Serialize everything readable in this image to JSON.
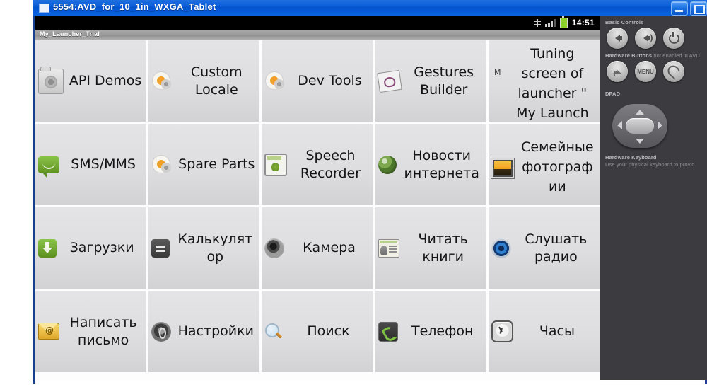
{
  "window": {
    "title": "5554:AVD_for_10_1in_WXGA_Tablet",
    "minimize_label": "",
    "maximize_label": ""
  },
  "statusbar": {
    "time": "14:51",
    "icons": [
      "usb-debug-icon",
      "signal-icon",
      "battery-icon"
    ]
  },
  "appbar": {
    "title": "My_Launcher_Trial"
  },
  "grid": {
    "cells": [
      {
        "label": "API Demos",
        "icon": "folder-gear-icon",
        "tall": false
      },
      {
        "label": "Custom Locale",
        "icon": "gear-flower-icon",
        "tall": false
      },
      {
        "label": "Dev Tools",
        "icon": "gear-flower-icon",
        "tall": false
      },
      {
        "label": "Gestures Builder",
        "icon": "gestures-icon",
        "tall": false
      },
      {
        "label": "Tuning screen of launcher \" My Launch",
        "icon": "m-letter-icon",
        "tall": true
      },
      {
        "label": "SMS/MMS",
        "icon": "sms-bubble-icon",
        "tall": false
      },
      {
        "label": "Spare Parts",
        "icon": "gear-flower-icon",
        "tall": false
      },
      {
        "label": "Speech Recorder",
        "icon": "speech-recorder-icon",
        "tall": false
      },
      {
        "label": "Новости интернета",
        "icon": "globe-icon",
        "tall": false
      },
      {
        "label": "Семейные фотографии",
        "icon": "photo-icon",
        "tall": true
      },
      {
        "label": "Загрузки",
        "icon": "download-icon",
        "tall": false
      },
      {
        "label": "Калькулятор",
        "icon": "calculator-icon",
        "tall": false
      },
      {
        "label": "Камера",
        "icon": "camera-icon",
        "tall": false
      },
      {
        "label": "Читать книги",
        "icon": "books-icon",
        "tall": false
      },
      {
        "label": "Слушать радио",
        "icon": "radio-icon",
        "tall": false
      },
      {
        "label": "Написать письмо",
        "icon": "mail-icon",
        "tall": false
      },
      {
        "label": "Настройки",
        "icon": "settings-icon",
        "tall": false
      },
      {
        "label": "Поиск",
        "icon": "search-icon",
        "tall": false
      },
      {
        "label": "Телефон",
        "icon": "phone-icon",
        "tall": false
      },
      {
        "label": "Часы",
        "icon": "clock-icon",
        "tall": false
      }
    ]
  },
  "controls": {
    "basic_controls_label": "Basic Controls",
    "volume_down_label": "",
    "volume_up_label": "",
    "power_label": "",
    "hardware_buttons_label": "Hardware Buttons",
    "hardware_buttons_note": " not enabled in AVD",
    "home_label": "",
    "menu_label": "MENU",
    "back_label": "",
    "dpad_label": "DPAD",
    "hardware_keyboard_label": "Hardware Keyboard",
    "hardware_keyboard_note": "Use your physical keyboard to provid"
  },
  "colors": {
    "titlebar": "#0a5ed8",
    "window_border": "#1a3f8f",
    "panel": "#3c3c40",
    "cell_top": "#e4e4e6",
    "cell_bottom": "#d2d2d4",
    "battery_green": "#8dd02a"
  }
}
